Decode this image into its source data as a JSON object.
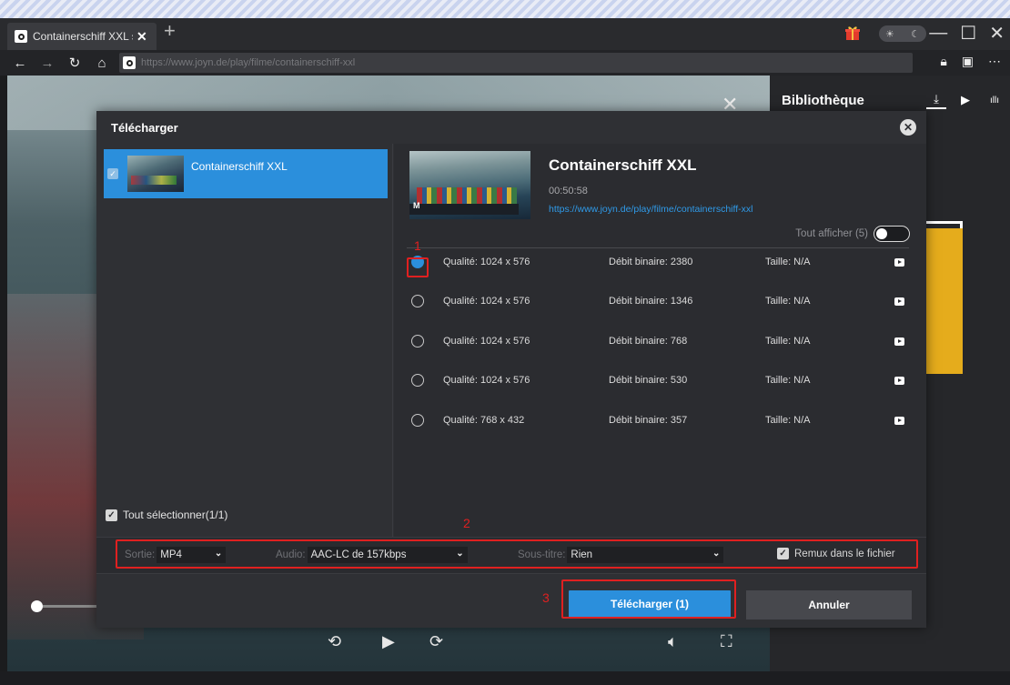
{
  "browser": {
    "tab_title": "Containerschiff XXL st",
    "url": "https://www.joyn.de/play/filme/containerschiff-xxl",
    "new_tab_symbol": "+",
    "window_controls": [
      "—",
      "☐",
      "✕"
    ],
    "theme_icons": [
      "sun-icon",
      "moon-icon"
    ]
  },
  "library": {
    "title": "Bibliothèque",
    "icons": [
      "download-icon",
      "video-icon",
      "audio-icon"
    ]
  },
  "dialog": {
    "title": "Télécharger",
    "list": [
      {
        "name": "Containerschiff XXL",
        "checked": true
      }
    ],
    "select_all_label": "Tout sélectionner(1/1)",
    "detail": {
      "title": "Containerschiff XXL",
      "duration": "00:50:58",
      "url": "https://www.joyn.de/play/filme/containerschiff-xxl",
      "show_all_label": "Tout afficher",
      "show_all_count": "(5)"
    },
    "qualities": [
      {
        "quality": "Qualité: 1024 x 576",
        "bitrate": "Débit binaire: 2380",
        "size": "Taille: N/A",
        "selected": true
      },
      {
        "quality": "Qualité: 1024 x 576",
        "bitrate": "Débit binaire: 1346",
        "size": "Taille: N/A",
        "selected": false
      },
      {
        "quality": "Qualité: 1024 x 576",
        "bitrate": "Débit binaire: 768",
        "size": "Taille: N/A",
        "selected": false
      },
      {
        "quality": "Qualité: 1024 x 576",
        "bitrate": "Débit binaire: 530",
        "size": "Taille: N/A",
        "selected": false
      },
      {
        "quality": "Qualité: 768 x 432",
        "bitrate": "Débit binaire: 357",
        "size": "Taille: N/A",
        "selected": false
      }
    ],
    "options": {
      "output_label": "Sortie:",
      "output_value": "MP4",
      "audio_label": "Audio:",
      "audio_value": "AAC-LC de 157kbps",
      "subtitle_label": "Sous-titre:",
      "subtitle_value": "Rien",
      "remux_label": "Remux dans le fichier"
    },
    "buttons": {
      "download": "Télécharger (1)",
      "cancel": "Annuler"
    },
    "annotations": [
      "1",
      "2",
      "3"
    ]
  },
  "colors": {
    "accent": "#2b8fdc",
    "highlight": "#e02020"
  }
}
